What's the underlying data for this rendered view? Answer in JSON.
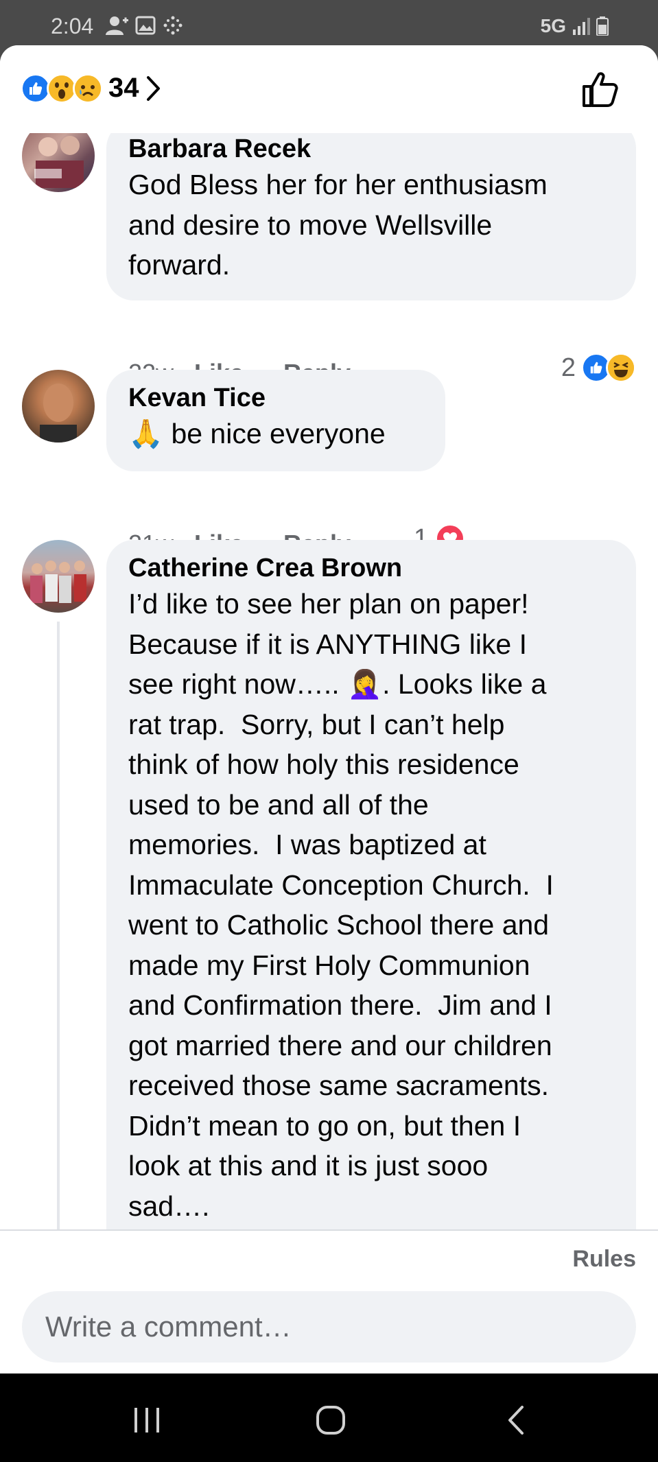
{
  "status_bar": {
    "time": "2:04",
    "network": "5G"
  },
  "header": {
    "reaction_count": "34"
  },
  "comments": [
    {
      "author": "Barbara Recek",
      "text": "God Bless her for her enthusiasm\nand desire to move Wellsville\nforward.",
      "time": "22w",
      "like_label": "Like",
      "reply_label": "Reply",
      "reaction_count": "2"
    },
    {
      "author": "Kevan Tice",
      "text": "🙏 be nice everyone",
      "time": "21w",
      "like_label": "Like",
      "reply_label": "Reply",
      "reaction_count": "1"
    },
    {
      "author": "Catherine Crea Brown",
      "text": "I’d like to see her plan on paper!\nBecause if it is ANYTHING like I\nsee right now….. 🤦‍♀️. Looks like a\nrat trap.  Sorry, but I can’t help\nthink of how holy this residence\nused to be and all of the\nmemories.  I was baptized at\nImmaculate Conception Church.  I\nwent to Catholic School there and\nmade my First Holy Communion\nand Confirmation there.  Jim and I\ngot married there and our children\nreceived those same sacraments.\nDidn’t mean to go on, but then I\nlook at this and it is just sooo\nsad…."
    }
  ],
  "footer": {
    "rules_label": "Rules",
    "comment_placeholder": "Write a comment…"
  },
  "icons": {
    "like": "like-icon",
    "wow": "wow-emoji-icon",
    "sad": "sad-emoji-icon",
    "haha": "haha-emoji-icon",
    "love": "love-icon",
    "thumb": "thumbs-up-outline-icon"
  },
  "colors": {
    "facebook_blue": "#1877f2",
    "bubble_gray": "#f0f2f5",
    "meta_gray": "#65676b",
    "love_red": "#f33e58"
  }
}
